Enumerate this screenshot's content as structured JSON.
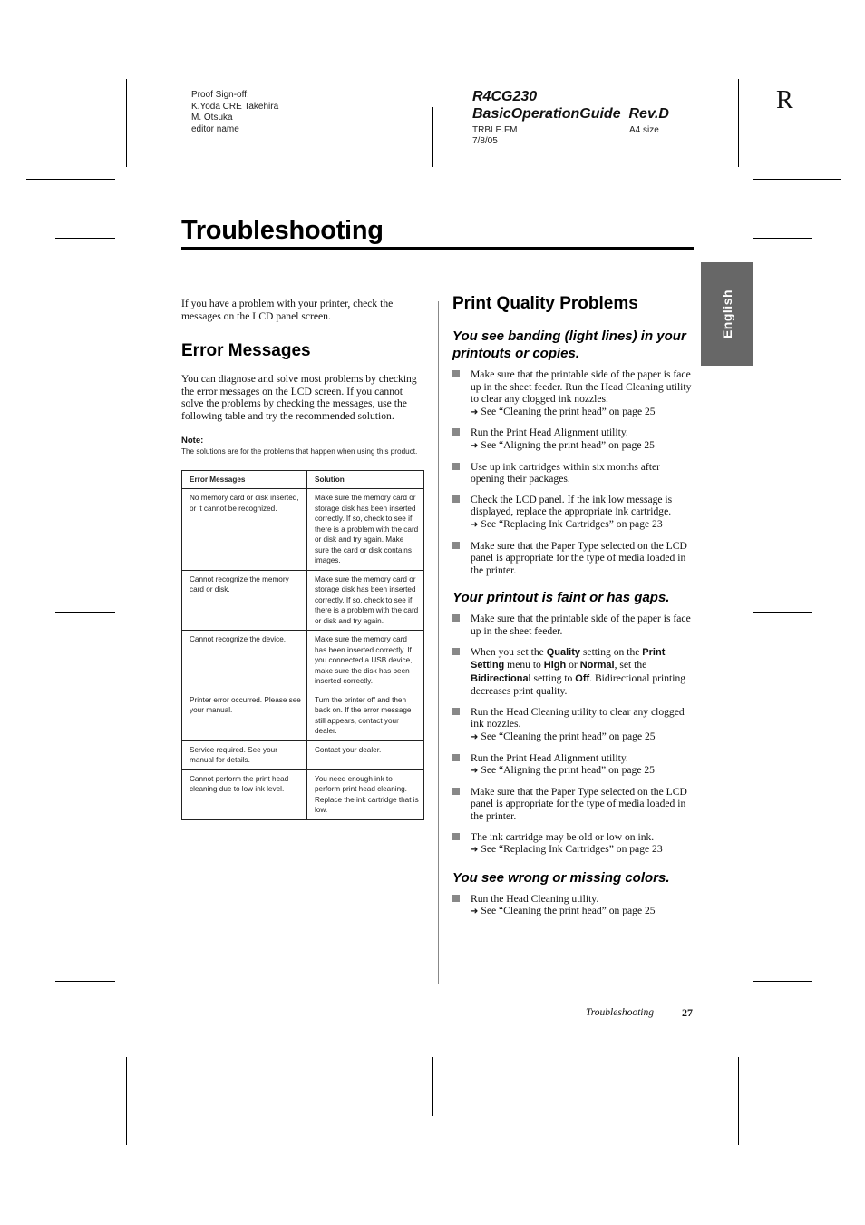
{
  "header": {
    "proof_lines": [
      "Proof Sign-off:",
      "K.Yoda CRE Takehira",
      "M. Otsuka",
      "editor name"
    ],
    "doc_id_line1": "R4CG230",
    "doc_id_line2": "BasicOperationGuide  Rev.D",
    "file_name": "TRBLE.FM",
    "date": "7/8/05",
    "paper_size": "A4 size",
    "corner_letter": "R"
  },
  "page_title": "Troubleshooting",
  "language_tab": "English",
  "left_column": {
    "intro": "If you have a problem with your printer, check the messages on the LCD panel screen.",
    "heading": "Error Messages",
    "body": "You can diagnose and solve most problems by checking the error messages on the LCD screen. If you cannot solve the problems by checking the messages, use the following table and try the recommended solution.",
    "note_label": "Note:",
    "note_text": "The solutions are for the problems that happen when using this product.",
    "table": {
      "headers": [
        "Error Messages",
        "Solution"
      ],
      "rows": [
        [
          "No memory card or disk inserted, or it cannot be recognized.",
          "Make sure the memory card or storage disk has been inserted correctly. If so, check to see if there is a problem with the card or disk and try again. Make sure the card or disk contains images."
        ],
        [
          "Cannot recognize the memory card or disk.",
          "Make sure the memory card or storage disk has been inserted correctly. If so, check to see if there is a problem with the card or disk and try again."
        ],
        [
          "Cannot recognize the device.",
          "Make sure the memory card has been inserted correctly. If you connected a USB device, make sure the disk has been inserted correctly."
        ],
        [
          "Printer error occurred. Please see your manual.",
          "Turn the printer off and then back on. If the error message still appears, contact your dealer."
        ],
        [
          "Service required. See your manual for details.",
          "Contact your dealer."
        ],
        [
          "Cannot perform the print head cleaning due to low ink level.",
          "You need enough ink to perform print head cleaning. Replace the ink cartridge that is low."
        ]
      ]
    }
  },
  "right_column": {
    "heading": "Print Quality Problems",
    "sections": [
      {
        "title": "You see banding (light lines) in your printouts or copies.",
        "items": [
          {
            "text": "Make sure that the printable side of the paper is face up in the sheet feeder. Run the Head Cleaning utility to clear any clogged ink nozzles.",
            "xref": "See “Cleaning the print head” on page 25"
          },
          {
            "text": "Run the Print Head Alignment utility.",
            "xref": "See “Aligning the print head” on page 25"
          },
          {
            "text": "Use up ink cartridges within six months after opening their packages.",
            "xref": null
          },
          {
            "text": "Check the LCD panel. If the ink low message is displayed, replace the appropriate ink cartridge.",
            "xref": "See “Replacing Ink Cartridges” on page 23"
          },
          {
            "text": "Make sure that the Paper Type selected on the LCD panel is appropriate for the type of media loaded in the printer.",
            "xref": null
          }
        ]
      },
      {
        "title": "Your printout is faint or has gaps.",
        "items": [
          {
            "text": "Make sure that the printable side of the paper is face up in the sheet feeder.",
            "xref": null
          },
          {
            "rich": [
              {
                "t": "When you set the "
              },
              {
                "b": "Quality"
              },
              {
                "t": " setting on the "
              },
              {
                "b": "Print Setting"
              },
              {
                "t": " menu to "
              },
              {
                "b": "High"
              },
              {
                "t": " or "
              },
              {
                "b": "Normal"
              },
              {
                "t": ", set the "
              },
              {
                "b": "Bidirectional"
              },
              {
                "t": " setting to "
              },
              {
                "b": "Off"
              },
              {
                "t": ". Bidirectional printing decreases print quality."
              }
            ],
            "xref": null
          },
          {
            "text": "Run the Head Cleaning utility to clear any clogged ink nozzles.",
            "xref": "See “Cleaning the print head” on page 25"
          },
          {
            "text": "Run the Print Head Alignment utility.",
            "xref": "See “Aligning the print head” on page 25"
          },
          {
            "text": "Make sure that the Paper Type selected on the LCD panel is appropriate for the type of media loaded in the printer.",
            "xref": null
          },
          {
            "text": "The ink cartridge may be old or low on ink.",
            "xref": "See “Replacing Ink Cartridges” on page 23"
          }
        ]
      },
      {
        "title": "You see wrong or missing colors.",
        "items": [
          {
            "text": "Run the Head Cleaning utility.",
            "xref": "See “Cleaning the print head” on page 25"
          }
        ]
      }
    ]
  },
  "footer": {
    "section_name": "Troubleshooting",
    "page_number": "27"
  },
  "icons": {
    "xref_arrow": "➜",
    "bullet": "square-bullet"
  },
  "colors": {
    "language_tab_bg": "#676767",
    "bullet": "#888888",
    "text": "#111111"
  }
}
